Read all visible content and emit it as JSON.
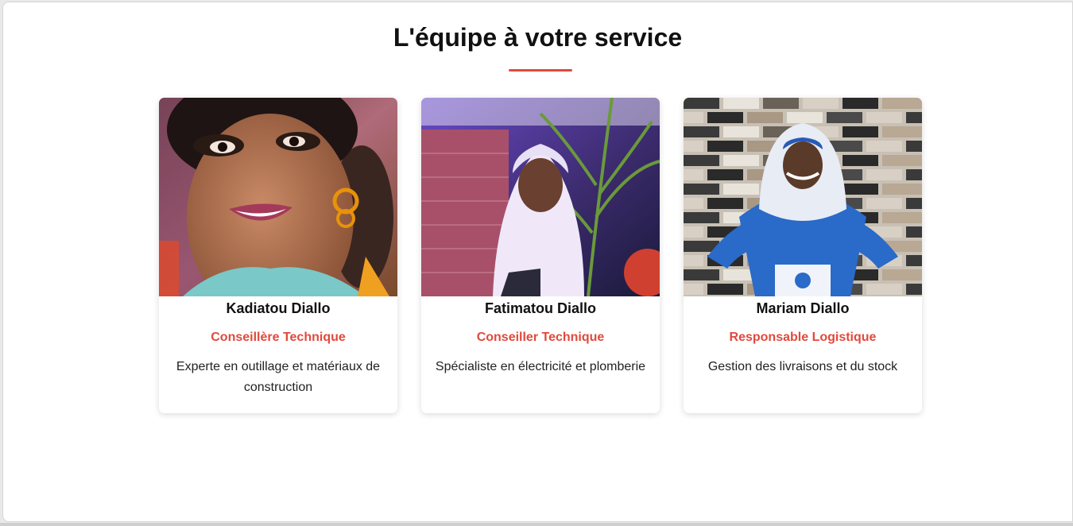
{
  "section": {
    "title": "L'équipe à votre service"
  },
  "team": [
    {
      "name": "Kadiatou Diallo",
      "role": "Conseillère Technique",
      "description": "Experte en outillage et matériaux de construction",
      "photo_icon": "portrait-photo"
    },
    {
      "name": "Fatimatou Diallo",
      "role": "Conseiller Technique",
      "description": "Spécialiste en électricité et plomberie",
      "photo_icon": "portrait-photo"
    },
    {
      "name": "Mariam Diallo",
      "role": "Responsable Logistique",
      "description": "Gestion des livraisons et du stock",
      "photo_icon": "portrait-photo"
    }
  ],
  "colors": {
    "accent": "#e04a3c",
    "text": "#111111",
    "background": "#ffffff"
  }
}
